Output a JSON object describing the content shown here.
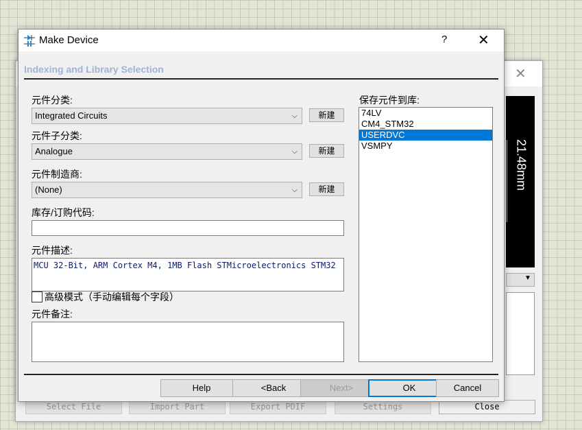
{
  "background_dialog": {
    "dimension": "21.48mm",
    "buttons": [
      "Select File",
      "Import Part",
      "Export PDIF",
      "Settings",
      "Close"
    ]
  },
  "dialog": {
    "title": "Make Device",
    "help": "?",
    "close": "✕",
    "section": "Indexing and Library Selection",
    "category": {
      "label": "元件分类:",
      "value": "Integrated Circuits",
      "new": "新建"
    },
    "subcategory": {
      "label": "元件子分类:",
      "value": "Analogue",
      "new": "新建"
    },
    "manufacturer": {
      "label": "元件制造商:",
      "value": "(None)",
      "new": "新建"
    },
    "stock_code": {
      "label": "库存/订购代码:",
      "value": ""
    },
    "description": {
      "label": "元件描述:",
      "value": "MCU 32-Bit, ARM Cortex M4, 1MB Flash STMicroelectronics STM32"
    },
    "advanced_mode": {
      "label": "高级模式（手动编辑每个字段）",
      "checked": false
    },
    "notes": {
      "label": "元件备注:",
      "value": ""
    },
    "library": {
      "label": "保存元件到库:",
      "items": [
        "74LV",
        "CM4_STM32",
        "USERDVC",
        "VSMPY"
      ],
      "selected": "USERDVC"
    },
    "buttons": {
      "help": "Help",
      "back": "<Back",
      "next": "Next>",
      "ok": "OK",
      "cancel": "Cancel"
    }
  }
}
